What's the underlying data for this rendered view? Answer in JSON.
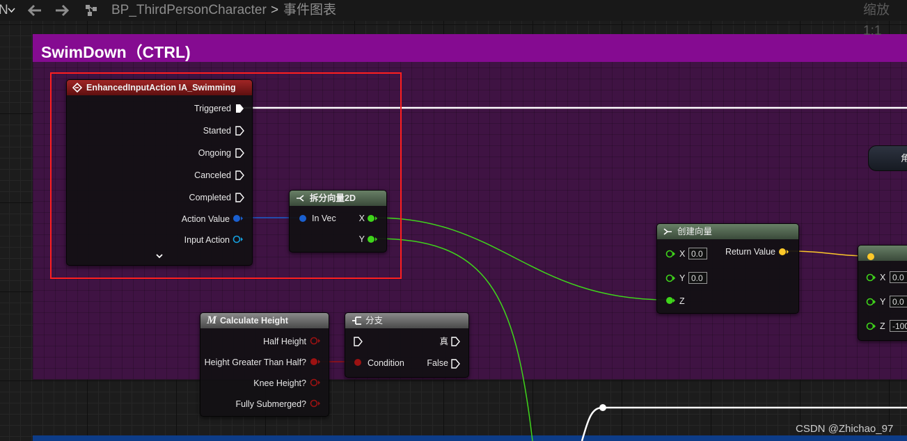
{
  "toolbar": {
    "left_glyph": "N",
    "dropdown_icon": "chevron-down-icon",
    "back_icon": "arrow-left-icon",
    "forward_icon": "arrow-right-icon",
    "blueprint_name": "BP_ThirdPersonCharacter",
    "separator": ">",
    "graph_name": "事件图表",
    "zoom": "缩放1:1"
  },
  "comment": {
    "title": "SwimDown（CTRL)",
    "color": "#850b91"
  },
  "nodes": {
    "input_action": {
      "title": "EnhancedInputAction IA_Swimming",
      "pins": {
        "triggered": "Triggered",
        "started": "Started",
        "ongoing": "Ongoing",
        "canceled": "Canceled",
        "completed": "Completed",
        "action_value": "Action Value",
        "input_action": "Input Action"
      }
    },
    "break_vector": {
      "title": "拆分向量2D",
      "in_vec": "In Vec",
      "x": "X",
      "y": "Y"
    },
    "make_vector": {
      "title": "创建向量",
      "x": "X",
      "x_value": "0.0",
      "y": "Y",
      "y_value": "0.0",
      "z": "Z",
      "return_value": "Return Value"
    },
    "calculate_height": {
      "title": "Calculate Height",
      "half_height": "Half Height",
      "height_greater": "Height Greater Than Half?",
      "knee_height": "Knee Height?",
      "fully_submerged": "Fully Submerged?"
    },
    "branch": {
      "title": "分支",
      "true_label": "真",
      "condition": "Condition",
      "false_label": "False"
    },
    "add_movement": {
      "x": "X",
      "x_value": "0.0",
      "y": "Y",
      "y_value": "0.0",
      "z": "Z",
      "z_value": "-100"
    },
    "partial_node": {
      "title": "角"
    }
  },
  "pin_colors": {
    "exec": "#ffffff",
    "struct": "#1a5fcf",
    "float": "#3fd41b",
    "vector": "#fdc829",
    "bool": "#9c1212"
  },
  "watermark": "CSDN @Zhichao_97"
}
